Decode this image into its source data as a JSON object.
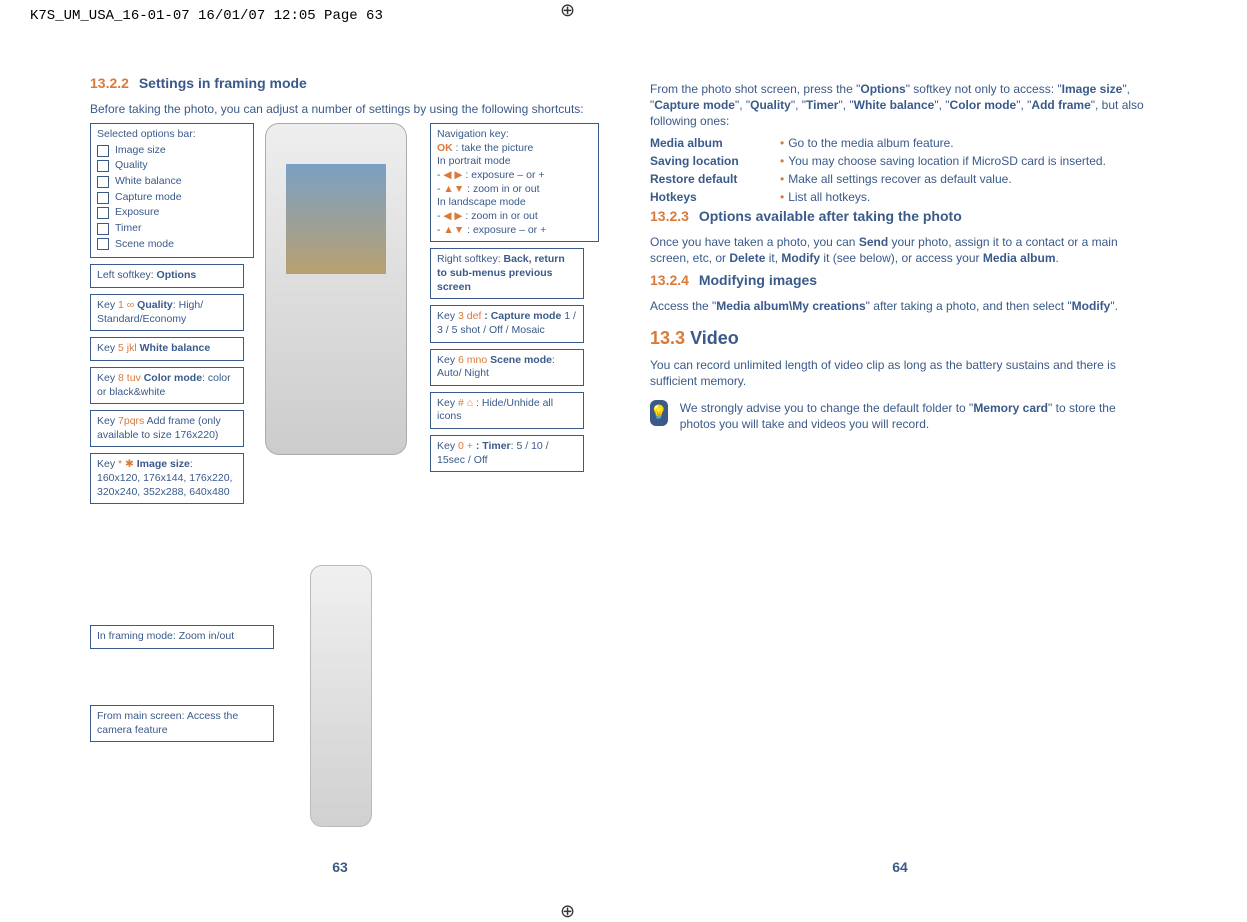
{
  "header": "K7S_UM_USA_16-01-07  16/01/07  12:05  Page 63",
  "left": {
    "sec_num": "13.2.2",
    "sec_title": "Settings in framing mode",
    "intro": "Before taking the photo, you can adjust a number of settings by using the following shortcuts:",
    "options_bar_hdr": "Selected options bar:",
    "options_bar": [
      "Image size",
      "Quality",
      "White balance",
      "Capture mode",
      "Exposure",
      "Timer",
      "Scene mode"
    ],
    "left_softkey": "Left softkey: ",
    "left_softkey_b": "Options",
    "key1_a": "Key ",
    "key1_sym": "1 ∞",
    "key1_b": " Quality",
    "key1_c": ": High/ Standard/Economy",
    "key5_a": "Key ",
    "key5_sym": "5 jkl",
    "key5_b": " White balance",
    "key8_a": "Key ",
    "key8_sym": "8 tuv",
    "key8_b": " Color mode",
    "key8_c": ": color or black&white",
    "key7_a": "Key ",
    "key7_sym": "7pqrs",
    "key7_c": " Add frame (only available to size 176x220)",
    "keystar_a": "Key ",
    "keystar_sym": "* ✱",
    "keystar_b": " Image size",
    "keystar_c": ": 160x120, 176x144, 176x220, 320x240, 352x288, 640x480",
    "nav_hdr": "Navigation key:",
    "nav_ok": "OK",
    "nav_ok_txt": " : take the picture",
    "nav_portrait": "In portrait mode",
    "nav_lr": "◀ ▶ : exposure – or +",
    "nav_ud": "▲▼ : zoom in or out",
    "nav_landscape": "In landscape mode",
    "nav_lr2": "◀ ▶ : zoom in or out",
    "nav_ud2": "▲▼ : exposure – or +",
    "right_softkey": "Right softkey: ",
    "right_softkey_b": "Back, return to sub-menus previous screen",
    "key3_a": "Key ",
    "key3_sym": "3 def",
    "key3_b": " : Capture mode",
    "key3_c": " 1 / 3 / 5 shot / Off / Mosaic",
    "key6_a": "Key ",
    "key6_sym": "6 mno",
    "key6_b": " Scene mode",
    "key6_c": ": Auto/ Night",
    "keyhash_a": "Key ",
    "keyhash_sym": "# ⌂",
    "keyhash_c": " : Hide/Unhide all icons",
    "key0_a": "Key ",
    "key0_sym": "0 +",
    "key0_b": " : Timer",
    "key0_c": ": 5 / 10 / 15sec / Off",
    "zoom": "In framing mode: Zoom in/out",
    "access": "From main screen: Access the camera feature",
    "page": "63"
  },
  "right": {
    "intro1a": "From the photo shot screen, press the \"",
    "intro1b": "Options",
    "intro1c": "\" softkey not only to access: \"",
    "t1": "Image size",
    "c1": "\", \"",
    "t2": "Capture mode",
    "c2": "\", \"",
    "t3": "Quality",
    "c3": "\", \"",
    "t4": "Timer",
    "c4": "\", \"",
    "t5": "White balance",
    "c5": "\", \"",
    "t6": "Color mode",
    "c6": "\", \"",
    "t7": "Add frame",
    "intro1d": "\", but also following ones:",
    "rows": [
      {
        "label": "Media album",
        "text": "Go to the media album feature."
      },
      {
        "label": "Saving location",
        "text": "You may choose saving location if MicroSD card is inserted."
      },
      {
        "label": "Restore default",
        "text": "Make all settings recover as default value."
      },
      {
        "label": "Hotkeys",
        "text": "List all hotkeys."
      }
    ],
    "s3_num": "13.2.3",
    "s3_title": "Options available after taking the photo",
    "s3_p_a": "Once you have taken a photo, you can ",
    "s3_send": "Send",
    "s3_p_b": " your photo, assign it to a contact or a main screen, etc, or ",
    "s3_del": "Delete",
    "s3_p_c": " it, ",
    "s3_mod": "Modify",
    "s3_p_d": " it (see below), or access your ",
    "s3_ma": "Media album",
    "s3_p_e": ".",
    "s4_num": "13.2.4",
    "s4_title": "Modifying images",
    "s4_p_a": "Access the \"",
    "s4_path": "Media album\\My creations",
    "s4_p_b": "\" after taking a photo, and then select \"",
    "s4_mod": "Modify",
    "s4_p_c": "\".",
    "s5_num": "13.3",
    "s5_title": "Video",
    "s5_p": "You can record unlimited length of video clip as long as the battery sustains and there is sufficient memory.",
    "tip_a": "We strongly advise you to change the default folder to \"",
    "tip_b": "Memory card",
    "tip_c": "\" to store the photos you will take and videos you will record.",
    "page": "64"
  }
}
